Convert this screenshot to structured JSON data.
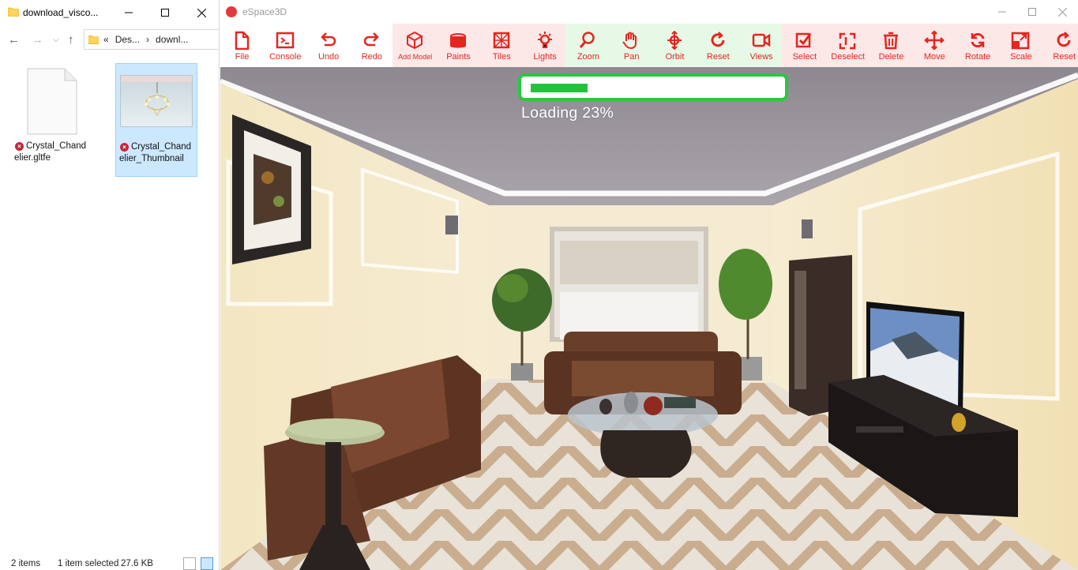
{
  "explorer": {
    "title": "download_visco...",
    "address": {
      "overflow": "«",
      "crumbs": [
        "Des...",
        "downl..."
      ]
    },
    "files": [
      {
        "name": "Crystal_Chandelier.gltfe",
        "status": "error",
        "selected": false
      },
      {
        "name": "Crystal_Chandelier_Thumbnail",
        "status": "error",
        "selected": true
      }
    ],
    "status": {
      "items": "2 items",
      "selected": "1 item selected",
      "size": "27.6 KB"
    }
  },
  "app": {
    "title": "eSpace3D",
    "brand_color": "#e5251f",
    "toolbar": [
      {
        "label": "File",
        "icon": "file-icon"
      },
      {
        "label": "Console",
        "icon": "console-icon"
      },
      {
        "label": "Undo",
        "icon": "undo-icon"
      },
      {
        "label": "Redo",
        "icon": "redo-icon"
      },
      {
        "label": "Add Model",
        "icon": "cube-icon"
      },
      {
        "label": "Paints",
        "icon": "paint-bucket-icon"
      },
      {
        "label": "Tiles",
        "icon": "tiles-icon"
      },
      {
        "label": "Lights",
        "icon": "bulb-icon"
      },
      {
        "label": "Zoom",
        "icon": "zoom-icon"
      },
      {
        "label": "Pan",
        "icon": "hand-icon"
      },
      {
        "label": "Orbit",
        "icon": "orbit-icon"
      },
      {
        "label": "Reset",
        "icon": "reset-icon"
      },
      {
        "label": "Views",
        "icon": "camera-icon"
      },
      {
        "label": "Select",
        "icon": "select-icon"
      },
      {
        "label": "Deselect",
        "icon": "deselect-icon"
      },
      {
        "label": "Delete",
        "icon": "trash-icon"
      },
      {
        "label": "Move",
        "icon": "move-icon"
      },
      {
        "label": "Rotate",
        "icon": "rotate-icon"
      },
      {
        "label": "Scale",
        "icon": "scale-icon"
      },
      {
        "label": "Reset",
        "icon": "reset-icon"
      }
    ],
    "loading": {
      "text": "Loading 23%",
      "progress": 0.23
    }
  }
}
